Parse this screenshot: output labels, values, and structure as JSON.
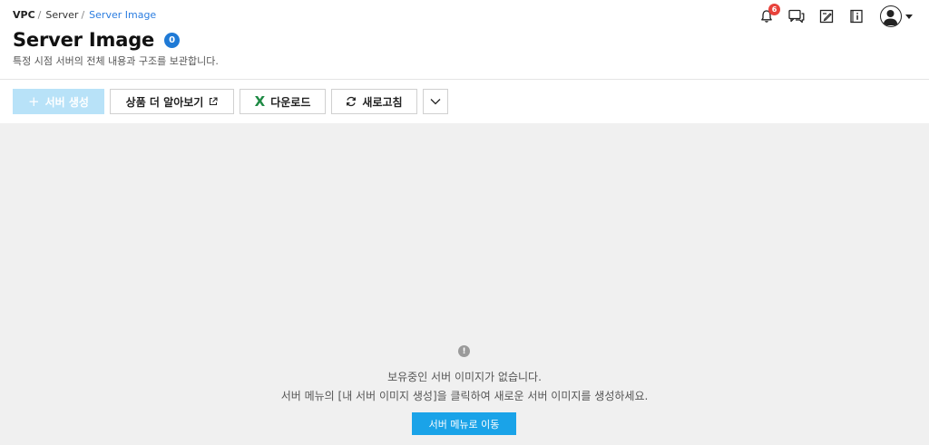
{
  "breadcrumb": {
    "root": "VPC",
    "mid": "Server",
    "current": "Server Image",
    "separator": "/"
  },
  "header": {
    "title": "Server Image",
    "count": "0",
    "subtitle": "특정 시점 서버의 전체 내용과 구조를 보관합니다."
  },
  "top_icons": {
    "notifications_count": "6",
    "icons": [
      "bell-icon",
      "chat-icon",
      "memo-icon",
      "info-book-icon",
      "user-avatar-icon"
    ]
  },
  "toolbar": {
    "create_label": "서버 생성",
    "create_icon": "plus-icon",
    "learn_more_label": "상품 더 알아보기",
    "download_label": "다운로드",
    "refresh_label": "새로고침"
  },
  "empty_state": {
    "icon_glyph": "!",
    "line1": "보유중인 서버 이미지가 없습니다.",
    "line2": "서버 메뉴의 [내 서버 이미지 생성]을 클릭하여 새로운 서버 이미지를 생성하세요.",
    "button_label": "서버 메뉴로 이동"
  },
  "colors": {
    "accent_blue": "#1f7ad6",
    "link_blue": "#2b7de0",
    "create_button_disabled": "#b8e2f8",
    "primary_button": "#1aa3e8",
    "badge_red": "#e8423b",
    "excel_green": "#1e8a44",
    "content_bg": "#f0f0f0"
  }
}
